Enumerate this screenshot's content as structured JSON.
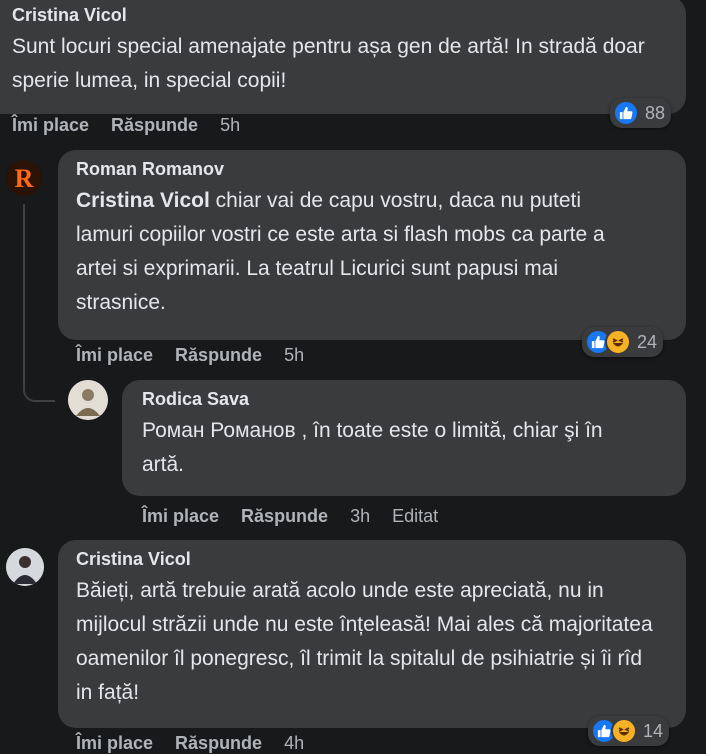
{
  "comments": [
    {
      "author": "Cristina Vicol",
      "text": "Sunt locuri special amenajate pentru așa gen de artă! In stradă doar sperie lumea, in special copii!",
      "like_label": "Îmi place",
      "reply_label": "Răspunde",
      "time": "5h",
      "reaction_count": "88"
    },
    {
      "author": "Roman Romanov",
      "mention": "Cristina Vicol",
      "text": "chiar vai de capu vostru, daca nu puteti lamuri copiilor vostri ce este arta si flash mobs ca parte a artei si exprimarii. La teatrul Licurici sunt papusi mai strasnice.",
      "like_label": "Îmi place",
      "reply_label": "Răspunde",
      "time": "5h",
      "reaction_count": "24",
      "avatar_letter": "R"
    },
    {
      "author": "Rodica Sava",
      "text": "Роман Романов , în toate este o limită, chiar şi în artă.",
      "like_label": "Îmi place",
      "reply_label": "Răspunde",
      "time": "3h",
      "edited": "Editat"
    },
    {
      "author": "Cristina Vicol",
      "text": "Băieți, artă trebuie arată acolo unde este apreciată, nu in mijlocul străzii unde nu este înțeleasă! Mai ales că majoritatea oamenilor îl ponegresc, îl trimit la spitalul de psihiatrie și îi rîd in față!",
      "like_label": "Îmi place",
      "reply_label": "Răspunde",
      "time": "4h",
      "reaction_count": "14"
    }
  ],
  "colors": {
    "background": "#18191a",
    "bubble": "#3a3b3c",
    "like": "#1877f2",
    "haha": "#f7b125",
    "secondary_text": "#b0b3b8"
  }
}
